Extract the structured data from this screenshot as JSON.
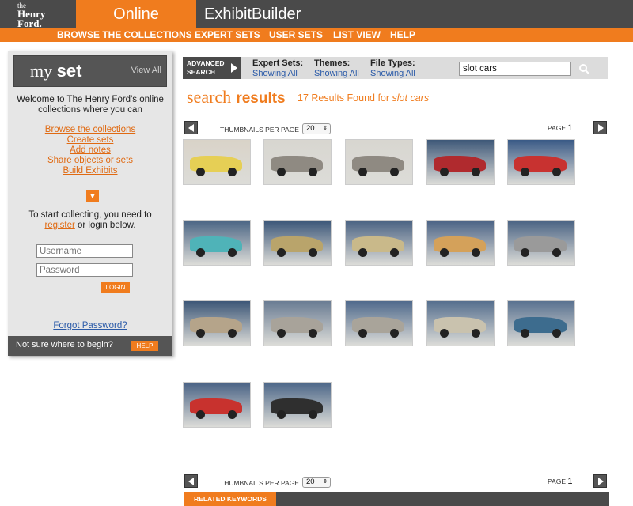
{
  "header": {
    "logo_line1": "the",
    "logo_line2": "Henry",
    "logo_line3": "Ford.",
    "tab_online": "Online Collections",
    "tab_exhibit": "ExhibitBuilder"
  },
  "nav": {
    "items": [
      "BROWSE THE COLLECTIONS",
      "EXPERT SETS",
      "USER SETS",
      "LIST VIEW",
      "HELP"
    ]
  },
  "sidebar": {
    "my": "my",
    "set": "set",
    "view_all": "View All",
    "welcome": "Welcome to The Henry Ford's online collections where you can",
    "links": [
      "Browse the collections",
      "Create sets",
      "Add notes",
      "Share objects or sets",
      "Build Exhibits"
    ],
    "to_start": "To start collecting, you need to",
    "register": "register",
    "or_login": "or login below.",
    "username_placeholder": "Username",
    "password_placeholder": "Password",
    "login": "LOGIN",
    "forgot": "Forgot Password?",
    "not_sure": "Not sure where to begin?",
    "help": "HELP"
  },
  "search": {
    "advanced_line1": "ADVANCED",
    "advanced_line2": "SEARCH",
    "filters": [
      {
        "label": "Expert Sets:",
        "value": "Showing All"
      },
      {
        "label": "Themes:",
        "value": "Showing All"
      },
      {
        "label": "File Types:",
        "value": "Showing All"
      }
    ],
    "query": "slot cars"
  },
  "results": {
    "title_thin": "search",
    "title_bold": "results",
    "count_text": "17 Results Found for",
    "query": "slot cars"
  },
  "pager": {
    "thumbs_per_page_label": "THUMBNAILS PER PAGE",
    "thumbs_per_page": "20",
    "page_label": "PAGE",
    "page": "1"
  },
  "thumbnails": [
    {
      "bg": "#d9d3c8",
      "car": "#e6cf55"
    },
    {
      "bg": "#d8d6d0",
      "car": "#8f8a82"
    },
    {
      "bg": "#d8d6d0",
      "car": "#8f8a82"
    },
    {
      "bg": "#3e5878",
      "car": "#b02a2e"
    },
    {
      "bg": "#3a5a86",
      "car": "#c83230"
    },
    {
      "bg": "#4b6584",
      "car": "#4fb3b8"
    },
    {
      "bg": "#3b5678",
      "car": "#b9a46b"
    },
    {
      "bg": "#4a6282",
      "car": "#c9b98a"
    },
    {
      "bg": "#4b6385",
      "car": "#d4a15a"
    },
    {
      "bg": "#4a6383",
      "car": "#9a9a9a"
    },
    {
      "bg": "#3d5777",
      "car": "#b5a48a"
    },
    {
      "bg": "#6a7c93",
      "car": "#a8a39a"
    },
    {
      "bg": "#506a8c",
      "car": "#a9a49a"
    },
    {
      "bg": "#566f8e",
      "car": "#c9c2ae"
    },
    {
      "bg": "#5a7290",
      "car": "#3d6c8e"
    },
    {
      "bg": "#4a6385",
      "car": "#c8322e"
    },
    {
      "bg": "#4d6788",
      "car": "#2f2f2f"
    }
  ],
  "related_keywords": "RELATED KEYWORDS",
  "colors": {
    "brand_orange": "#f07c1e",
    "dark_gray": "#4a4a4a",
    "link_blue": "#2a5aa8"
  }
}
